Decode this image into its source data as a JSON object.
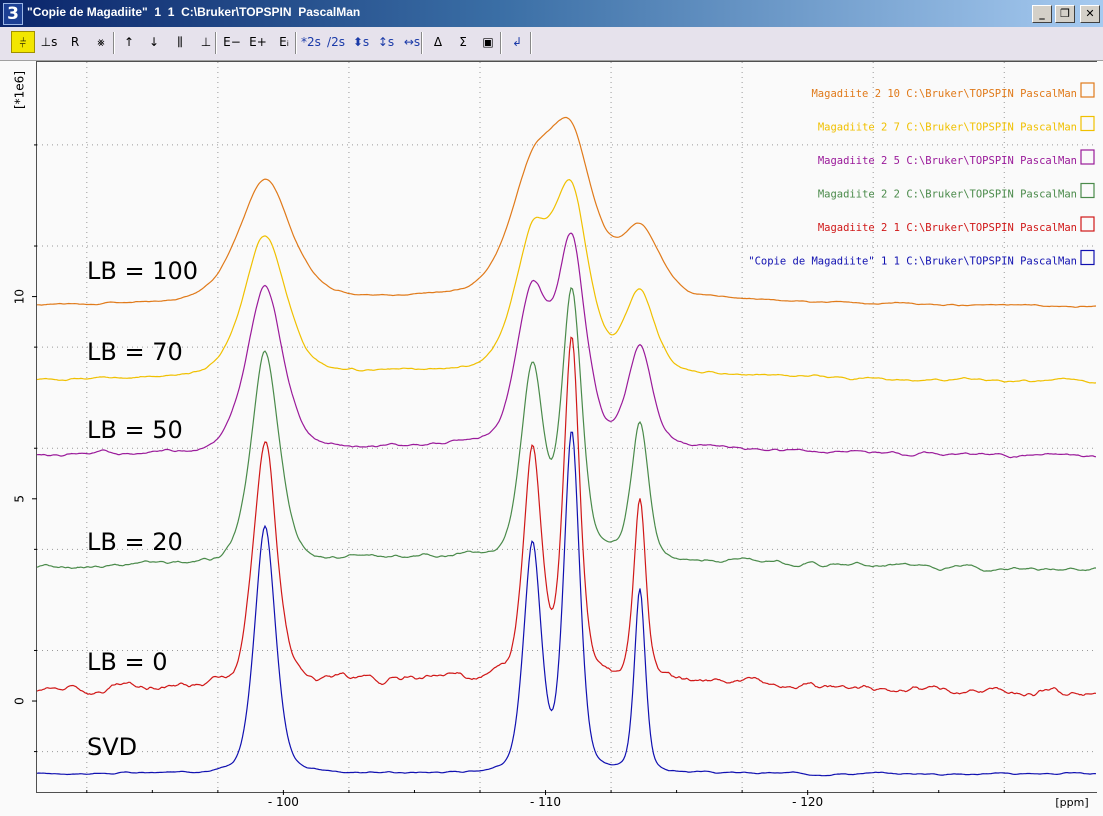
{
  "window": {
    "number": "3",
    "title": "\"Copie de Magadiite\"  1  1  C:\\Bruker\\TOPSPIN  PascalMan",
    "buttons": {
      "minimize": "_",
      "restore": "❐",
      "close": "✕"
    }
  },
  "toolbar": [
    {
      "name": "multiple-display-button",
      "glyph": "⫩",
      "active": true
    },
    {
      "name": "scale-button",
      "glyph": "⊥s"
    },
    {
      "name": "reset-button",
      "glyph": "R"
    },
    {
      "name": "remove-spectrum-button",
      "glyph": "⨳"
    },
    {
      "name": "shift-up-button",
      "glyph": "↑"
    },
    {
      "name": "shift-down-button",
      "glyph": "↓"
    },
    {
      "name": "stack-button",
      "glyph": "⫼"
    },
    {
      "name": "baseline-button",
      "glyph": "⊥"
    },
    {
      "name": "expand-minus-button",
      "glyph": "E−"
    },
    {
      "name": "expand-plus-button",
      "glyph": "E+"
    },
    {
      "name": "expand-info-button",
      "glyph": "Eᵢ"
    },
    {
      "name": "scale-double-button",
      "glyph": "*2s"
    },
    {
      "name": "scale-half-button",
      "glyph": "/2s"
    },
    {
      "name": "vertical-shift-button",
      "glyph": "⬍s"
    },
    {
      "name": "vertical-scale-button",
      "glyph": "↕s"
    },
    {
      "name": "horizontal-shift-button",
      "glyph": "↔s"
    },
    {
      "name": "difference-button",
      "glyph": "Δ"
    },
    {
      "name": "sum-button",
      "glyph": "Σ"
    },
    {
      "name": "save-button",
      "glyph": "▣"
    },
    {
      "name": "return-button",
      "glyph": "↲"
    }
  ],
  "labels": [
    "LB = 100",
    "LB = 70",
    "LB = 50",
    "LB = 20",
    "LB = 0",
    "SVD"
  ],
  "legend": [
    {
      "text": "Magadiite  2  10  C:\\Bruker\\TOPSPIN  PascalMan",
      "color": "#e07a1a"
    },
    {
      "text": "Magadiite  2  7  C:\\Bruker\\TOPSPIN  PascalMan",
      "color": "#f0c000"
    },
    {
      "text": "Magadiite  2  5  C:\\Bruker\\TOPSPIN  PascalMan",
      "color": "#9a1a9a"
    },
    {
      "text": "Magadiite  2  2  C:\\Bruker\\TOPSPIN  PascalMan",
      "color": "#4a8a4a"
    },
    {
      "text": "Magadiite  2  1  C:\\Bruker\\TOPSPIN  PascalMan",
      "color": "#d01818"
    },
    {
      "text": "\"Copie de Magadiite\"  1  1  C:\\Bruker\\TOPSPIN  PascalMan",
      "color": "#1010b0"
    }
  ],
  "chart_data": {
    "type": "line",
    "xlabel": "[ppm]",
    "ylabel": "[*1e6]",
    "xlim": [
      -90.6,
      -131.0
    ],
    "ylim": [
      -2.2,
      15.8
    ],
    "x_ticks": [
      -100,
      -110,
      -120
    ],
    "y_ticks": [
      0,
      5,
      10
    ],
    "grid": true,
    "legend_position": "top-right",
    "peaks_ppm": [
      -99.3,
      -109.5,
      -111.0,
      -113.6
    ],
    "series": [
      {
        "name": "\"Copie de Magadiite\"  1  1",
        "label": "SVD",
        "color": "#1010b0",
        "offset": -1.8,
        "heights": [
          6.1,
          5.6,
          8.4,
          4.5
        ],
        "widths": [
          0.42,
          0.35,
          0.32,
          0.22
        ],
        "broad": 0.0,
        "noise": 0.02
      },
      {
        "name": "Magadiite  2  1",
        "label": "LB = 0",
        "color": "#d01818",
        "offset": 0.2,
        "heights": [
          6.1,
          5.6,
          8.4,
          4.3
        ],
        "widths": [
          0.46,
          0.36,
          0.32,
          0.24
        ],
        "broad": 0.12,
        "noise": 0.09
      },
      {
        "name": "Magadiite  2  2",
        "label": "LB = 20",
        "color": "#4a8a4a",
        "offset": 3.25,
        "heights": [
          5.2,
          4.7,
          6.5,
          3.3
        ],
        "widths": [
          0.55,
          0.45,
          0.4,
          0.34
        ],
        "broad": 0.1,
        "noise": 0.05
      },
      {
        "name": "Magadiite  2  5",
        "label": "LB = 50",
        "color": "#9a1a9a",
        "offset": 6.05,
        "heights": [
          4.1,
          3.8,
          4.9,
          2.45
        ],
        "widths": [
          0.72,
          0.62,
          0.56,
          0.48
        ],
        "broad": 0.08,
        "noise": 0.04
      },
      {
        "name": "Magadiite  2  7",
        "label": "LB = 70",
        "color": "#f0c000",
        "offset": 7.9,
        "heights": [
          3.5,
          3.2,
          4.2,
          1.95
        ],
        "widths": [
          0.85,
          0.75,
          0.68,
          0.6
        ],
        "broad": 0.07,
        "noise": 0.03
      },
      {
        "name": "Magadiite  2  10",
        "label": "LB = 100",
        "color": "#e07a1a",
        "offset": 9.75,
        "heights": [
          3.0,
          2.8,
          3.5,
          1.65
        ],
        "widths": [
          1.05,
          0.95,
          0.88,
          0.78
        ],
        "broad": 0.07,
        "noise": 0.02
      }
    ]
  }
}
